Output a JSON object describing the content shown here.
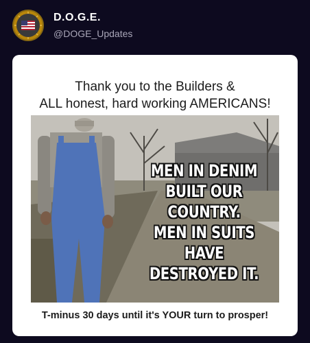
{
  "post": {
    "author_name": "D.O.G.E.",
    "author_handle": "@DOGE_Updates"
  },
  "card": {
    "headline_line1": "Thank you to the Builders &",
    "headline_line2": "ALL honest, hard working AMERICANS!",
    "meme_line1": "MEN IN DENIM",
    "meme_line2": "BUILT OUR COUNTRY.",
    "meme_line3": "MEN IN SUITS",
    "meme_line4": "HAVE",
    "meme_line5": "DESTROYED IT.",
    "caption": "T-minus 30 days until it's YOUR turn to prosper!"
  },
  "icons": {
    "avatar": "us-flag-seal-icon"
  },
  "colors": {
    "background": "#0d0a1f",
    "card": "#ffffff",
    "handle": "#a9a6b8"
  }
}
